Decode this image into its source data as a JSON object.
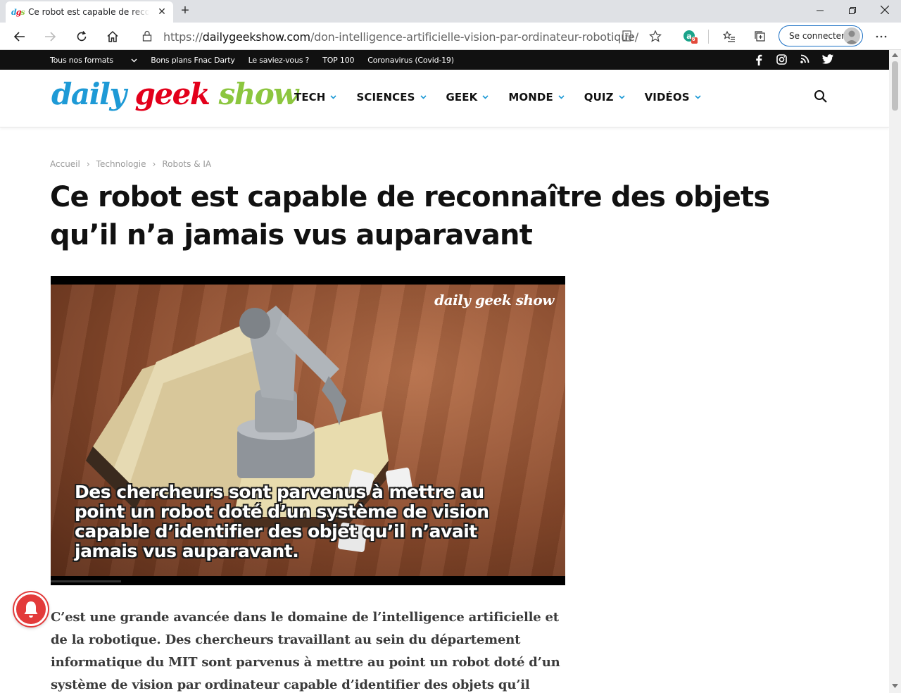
{
  "browser": {
    "tab_title": "Ce robot est capable de reconnaître des objets qu'il n'a jamais vus auparavant",
    "tab_favicon": "dgs",
    "url_scheme": "https://",
    "url_host": "dailygeekshow.com",
    "url_path": "/don-intelligence-artificielle-vision-par-ordinateur-robotique/",
    "extension_badge": "6",
    "signin_label": "Se connecter"
  },
  "topbar": {
    "links": [
      "Tous nos formats",
      "Bons plans Fnac Darty",
      "Le saviez-vous ?",
      "TOP 100",
      "Coronavirus (Covid-19)"
    ],
    "social_icons": [
      "facebook-icon",
      "instagram-icon",
      "rss-icon",
      "twitter-icon"
    ]
  },
  "nav": {
    "logo": {
      "part1": "daily",
      "part2": "geek",
      "part3": "show"
    },
    "items": [
      "TECH",
      "SCIENCES",
      "GEEK",
      "MONDE",
      "QUIZ",
      "VIDÉOS"
    ]
  },
  "breadcrumb": [
    "Accueil",
    "Technologie",
    "Robots & IA"
  ],
  "article": {
    "title": "Ce robot est capable de reconnaître des objets qu’il n’a jamais vus auparavant",
    "video_watermark": "daily geek show",
    "video_caption": "Des chercheurs sont parvenus à mettre au point un robot doté d’un système de vision capable d’identifier des objet qu’il n’avait jamais vus auparavant.",
    "lead": "C’est une grande avancée dans le domaine de l’intelligence artificielle et de la robotique. Des chercheurs travaillant au sein du département informatique du MIT sont parvenus à mettre au point un robot doté d’un système de vision par ordinateur capable d’identifier des objets qu’il n’avait jamais vus"
  },
  "colors": {
    "logo_blue": "#1e9ad6",
    "logo_red": "#e3001b",
    "logo_green": "#8cc63f",
    "nav_chevron": "#1e9ad6",
    "notification": "#e33b3b"
  }
}
